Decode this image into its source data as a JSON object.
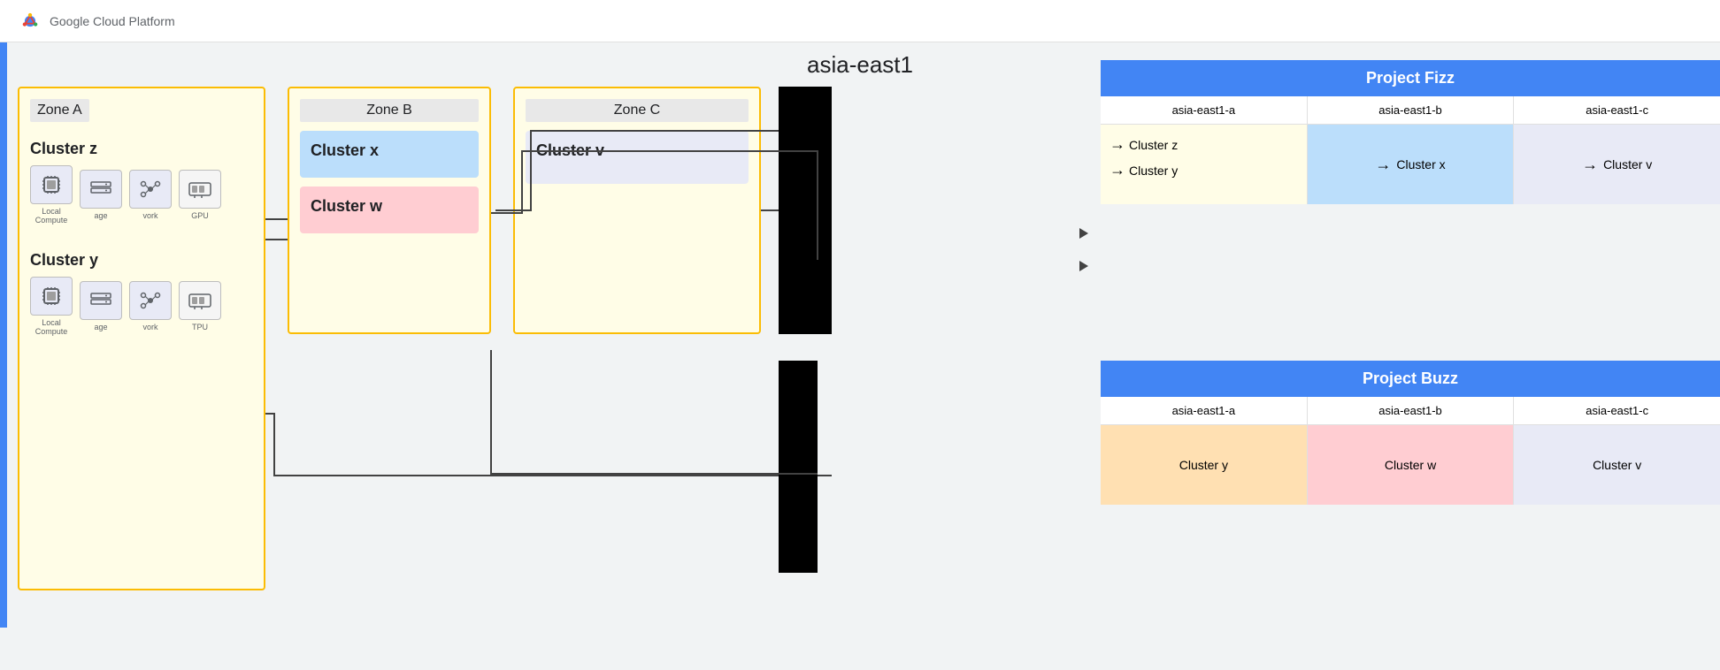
{
  "topbar": {
    "logo_text": "Google Cloud Platform"
  },
  "region": {
    "name": "asia-east1"
  },
  "zones": {
    "zone_a": {
      "label": "Zone A",
      "cluster_z": {
        "label": "Cluster z",
        "nodes": [
          {
            "name": "local-compute",
            "label": "Local\nCompute",
            "icon": "⚙"
          },
          {
            "name": "storage",
            "label": "age",
            "icon": "≡"
          },
          {
            "name": "network",
            "label": "vork",
            "icon": "▷"
          },
          {
            "name": "gpu",
            "label": "GPU",
            "icon": "⊞"
          }
        ]
      },
      "cluster_y": {
        "label": "Cluster y",
        "nodes": [
          {
            "name": "local-compute",
            "label": "Local\nCompute",
            "icon": "⚙"
          },
          {
            "name": "storage",
            "label": "age",
            "icon": "≡"
          },
          {
            "name": "network",
            "label": "vork",
            "icon": "▷"
          },
          {
            "name": "tpu",
            "label": "TPU",
            "icon": "⊞"
          }
        ]
      }
    },
    "zone_b": {
      "label": "Zone B",
      "cluster_x": {
        "label": "Cluster x",
        "color": "blue"
      },
      "cluster_w": {
        "label": "Cluster w",
        "color": "red"
      }
    },
    "zone_c": {
      "label": "Zone C",
      "cluster_v": {
        "label": "Cluster v",
        "color": "purple"
      }
    }
  },
  "projects": {
    "fizz": {
      "title": "Project Fizz",
      "zones": [
        "asia-east1-a",
        "asia-east1-b",
        "asia-east1-c"
      ],
      "zone_a_clusters": [
        "Cluster z",
        "Cluster y"
      ],
      "zone_b_clusters": [
        "Cluster x"
      ],
      "zone_c_clusters": [
        "Cluster v"
      ]
    },
    "buzz": {
      "title": "Project Buzz",
      "zones": [
        "asia-east1-a",
        "asia-east1-b",
        "asia-east1-c"
      ],
      "zone_a_clusters": [
        "Cluster y"
      ],
      "zone_b_clusters": [
        "Cluster w"
      ],
      "zone_c_clusters": [
        "Cluster v"
      ]
    }
  }
}
